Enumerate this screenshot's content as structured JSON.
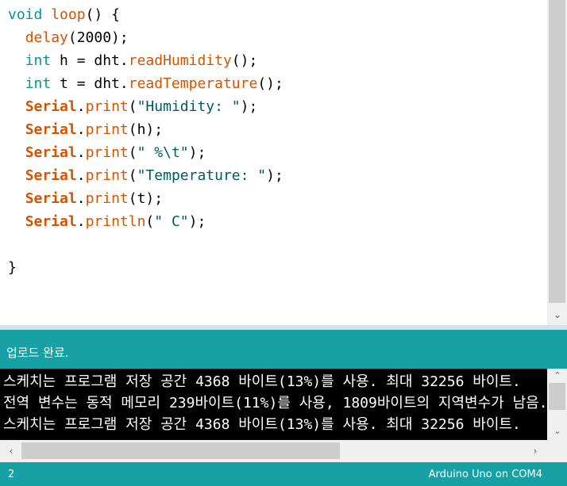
{
  "editor": {
    "lines": [
      [
        {
          "t": "void",
          "c": "kw-type"
        },
        {
          "t": " ",
          "c": "plain"
        },
        {
          "t": "loop",
          "c": "kw-fn"
        },
        {
          "t": "() {",
          "c": "plain"
        }
      ],
      [
        {
          "t": "  ",
          "c": "plain"
        },
        {
          "t": "delay",
          "c": "kw-fn"
        },
        {
          "t": "(2000);",
          "c": "plain"
        }
      ],
      [
        {
          "t": "  ",
          "c": "plain"
        },
        {
          "t": "int",
          "c": "kw-type"
        },
        {
          "t": " h = dht.",
          "c": "plain"
        },
        {
          "t": "readHumidity",
          "c": "kw-fn"
        },
        {
          "t": "();",
          "c": "plain"
        }
      ],
      [
        {
          "t": "  ",
          "c": "plain"
        },
        {
          "t": "int",
          "c": "kw-type"
        },
        {
          "t": " t = dht.",
          "c": "plain"
        },
        {
          "t": "readTemperature",
          "c": "kw-fn"
        },
        {
          "t": "();",
          "c": "plain"
        }
      ],
      [
        {
          "t": "  ",
          "c": "plain"
        },
        {
          "t": "Serial",
          "c": "kw-serial"
        },
        {
          "t": ".",
          "c": "plain"
        },
        {
          "t": "print",
          "c": "kw-fn"
        },
        {
          "t": "(",
          "c": "plain"
        },
        {
          "t": "\"Humidity: \"",
          "c": "str"
        },
        {
          "t": ");",
          "c": "plain"
        }
      ],
      [
        {
          "t": "  ",
          "c": "plain"
        },
        {
          "t": "Serial",
          "c": "kw-serial"
        },
        {
          "t": ".",
          "c": "plain"
        },
        {
          "t": "print",
          "c": "kw-fn"
        },
        {
          "t": "(h);",
          "c": "plain"
        }
      ],
      [
        {
          "t": "  ",
          "c": "plain"
        },
        {
          "t": "Serial",
          "c": "kw-serial"
        },
        {
          "t": ".",
          "c": "plain"
        },
        {
          "t": "print",
          "c": "kw-fn"
        },
        {
          "t": "(",
          "c": "plain"
        },
        {
          "t": "\" %\\t\"",
          "c": "str"
        },
        {
          "t": ");",
          "c": "plain"
        }
      ],
      [
        {
          "t": "  ",
          "c": "plain"
        },
        {
          "t": "Serial",
          "c": "kw-serial"
        },
        {
          "t": ".",
          "c": "plain"
        },
        {
          "t": "print",
          "c": "kw-fn"
        },
        {
          "t": "(",
          "c": "plain"
        },
        {
          "t": "\"Temperature: \"",
          "c": "str"
        },
        {
          "t": ");",
          "c": "plain"
        }
      ],
      [
        {
          "t": "  ",
          "c": "plain"
        },
        {
          "t": "Serial",
          "c": "kw-serial"
        },
        {
          "t": ".",
          "c": "plain"
        },
        {
          "t": "print",
          "c": "kw-fn"
        },
        {
          "t": "(t);",
          "c": "plain"
        }
      ],
      [
        {
          "t": "  ",
          "c": "plain"
        },
        {
          "t": "Serial",
          "c": "kw-serial"
        },
        {
          "t": ".",
          "c": "plain"
        },
        {
          "t": "println",
          "c": "kw-fn"
        },
        {
          "t": "(",
          "c": "plain"
        },
        {
          "t": "\" C\"",
          "c": "str"
        },
        {
          "t": ");",
          "c": "plain"
        }
      ],
      [
        {
          "t": "",
          "c": "plain"
        }
      ],
      [
        {
          "t": "}",
          "c": "plain"
        }
      ]
    ]
  },
  "status": {
    "message": "업로드 완료."
  },
  "console": {
    "lines": [
      "스케치는 프로그램 저장 공간 4368 바이트(13%)를 사용. 최대 32256 바이트.",
      "전역 변수는 동적 메모리 239바이트(11%)를 사용, 1809바이트의 지역변수가 남음.",
      "스케치는 프로그램 저장 공간 4368 바이트(13%)를 사용. 최대 32256 바이트."
    ]
  },
  "footer": {
    "line_number": "2",
    "board": "Arduino Uno on COM4"
  },
  "scrollbars": {
    "arrow_up": "▲",
    "arrow_down": "▼",
    "arrow_left": "◀",
    "arrow_right": "▶",
    "chevron_down": "⌄",
    "chevron_up": "⌃",
    "chevron_left": "‹",
    "chevron_right": "›"
  }
}
